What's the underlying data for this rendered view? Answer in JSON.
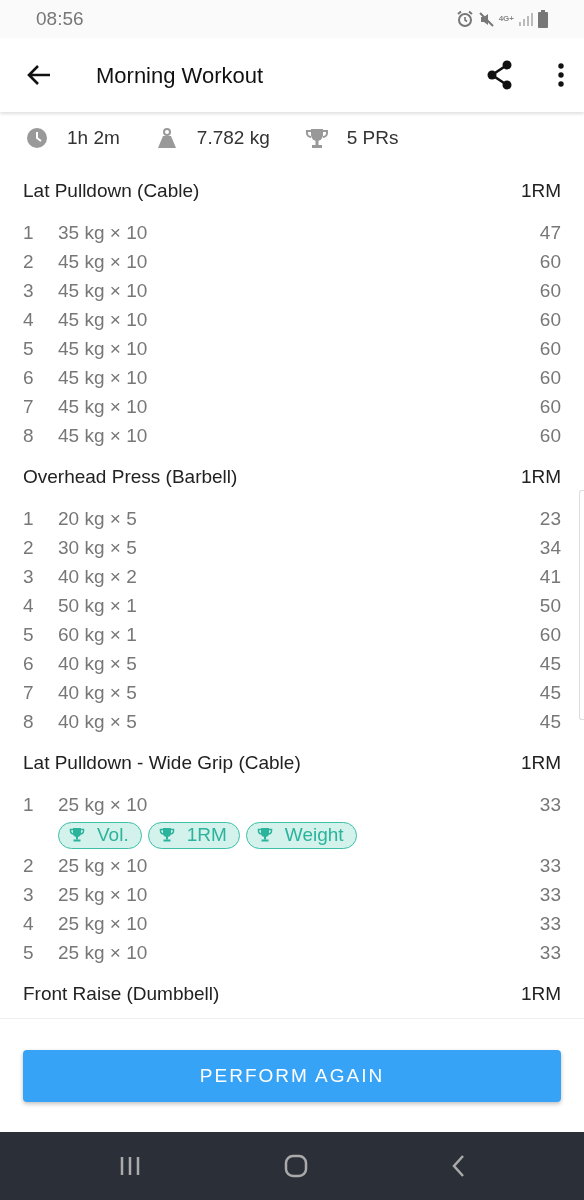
{
  "status_bar": {
    "time": "08:56",
    "network": "4G+"
  },
  "app_bar": {
    "title": "Morning Workout"
  },
  "summary": [
    {
      "kind": "duration",
      "text": "1h 2m"
    },
    {
      "kind": "weight",
      "text": "7.782 kg"
    },
    {
      "kind": "prs",
      "text": "5 PRs"
    }
  ],
  "exercises": [
    {
      "name": "Lat Pulldown (Cable)",
      "metric": "1RM",
      "sets": [
        {
          "number": "1",
          "weight": "35 kg × 10",
          "value": "47"
        },
        {
          "number": "2",
          "weight": "45 kg × 10",
          "value": "60"
        },
        {
          "number": "3",
          "weight": "45 kg × 10",
          "value": "60"
        },
        {
          "number": "4",
          "weight": "45 kg × 10",
          "value": "60"
        },
        {
          "number": "5",
          "weight": "45 kg × 10",
          "value": "60"
        },
        {
          "number": "6",
          "weight": "45 kg × 10",
          "value": "60"
        },
        {
          "number": "7",
          "weight": "45 kg × 10",
          "value": "60"
        },
        {
          "number": "8",
          "weight": "45 kg × 10",
          "value": "60"
        }
      ]
    },
    {
      "name": "Overhead Press (Barbell)",
      "metric": "1RM",
      "sets": [
        {
          "number": "1",
          "weight": "20 kg × 5",
          "value": "23"
        },
        {
          "number": "2",
          "weight": "30 kg × 5",
          "value": "34"
        },
        {
          "number": "3",
          "weight": "40 kg × 2",
          "value": "41"
        },
        {
          "number": "4",
          "weight": "50 kg × 1",
          "value": "50"
        },
        {
          "number": "5",
          "weight": "60 kg × 1",
          "value": "60"
        },
        {
          "number": "6",
          "weight": "40 kg × 5",
          "value": "45"
        },
        {
          "number": "7",
          "weight": "40 kg × 5",
          "value": "45"
        },
        {
          "number": "8",
          "weight": "40 kg × 5",
          "value": "45"
        }
      ]
    },
    {
      "name": "Lat Pulldown - Wide Grip (Cable)",
      "metric": "1RM",
      "sets": [
        {
          "number": "1",
          "weight": "25 kg × 10",
          "value": "33",
          "prs": [
            "Vol.",
            "1RM",
            "Weight"
          ]
        },
        {
          "number": "2",
          "weight": "25 kg × 10",
          "value": "33"
        },
        {
          "number": "3",
          "weight": "25 kg × 10",
          "value": "33"
        },
        {
          "number": "4",
          "weight": "25 kg × 10",
          "value": "33"
        },
        {
          "number": "5",
          "weight": "25 kg × 10",
          "value": "33"
        }
      ]
    },
    {
      "name": "Front Raise (Dumbbell)",
      "metric": "1RM"
    }
  ],
  "action_button": "PERFORM AGAIN"
}
